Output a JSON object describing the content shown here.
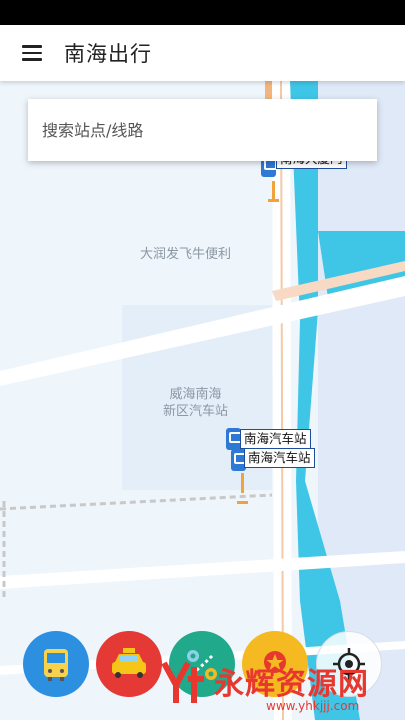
{
  "app": {
    "title": "南海出行"
  },
  "search": {
    "placeholder": "搜索站点/线路"
  },
  "map": {
    "labels": {
      "poi1": "大润发飞牛便利",
      "poi2_line1": "威海南海",
      "poi2_line2": "新区汽车站"
    },
    "stops": [
      {
        "name": "南海汽车站"
      },
      {
        "name": "南海汽车站"
      }
    ],
    "partial_stop_text": "南海大厦门"
  },
  "fabs": [
    {
      "icon": "bus-icon",
      "color": "#2d8fe0"
    },
    {
      "icon": "taxi-icon",
      "color": "#e53935"
    },
    {
      "icon": "route-icon",
      "color": "#21a98b"
    },
    {
      "icon": "favorite-star-icon",
      "color": "#f5b921"
    },
    {
      "icon": "locate-icon",
      "color": "#ffffff"
    }
  ],
  "watermark": {
    "text": "永辉资源网",
    "url": "www.yhkjjj.com"
  }
}
